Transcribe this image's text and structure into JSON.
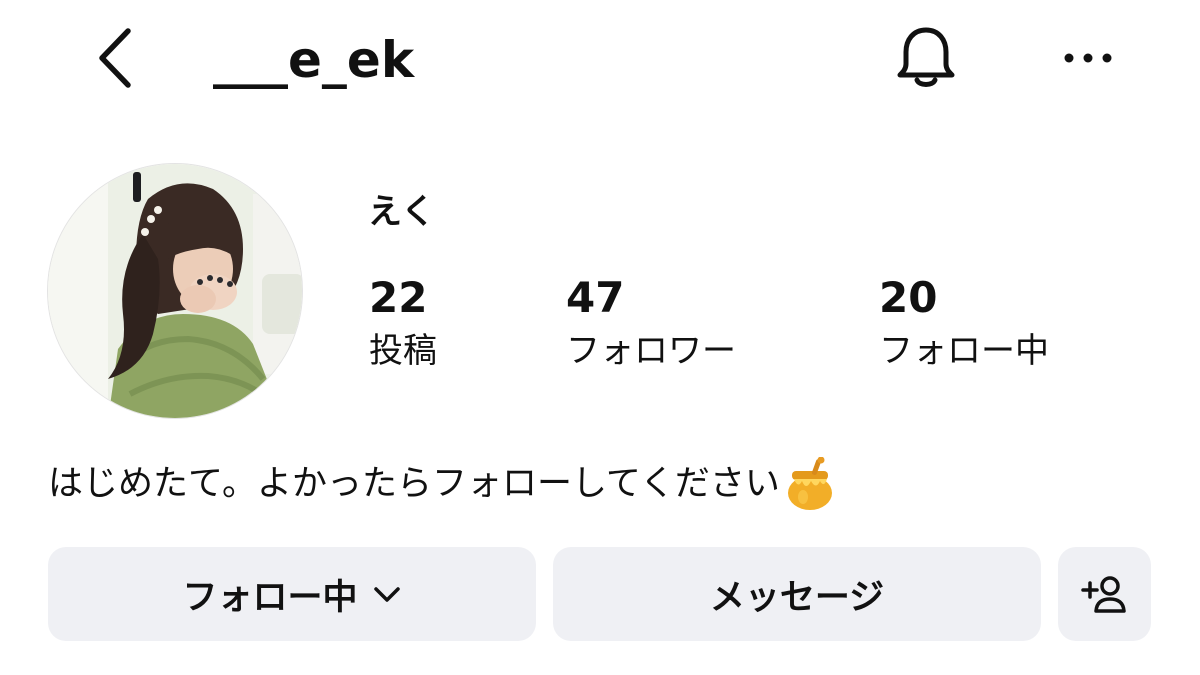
{
  "header": {
    "back_icon": "chevron-left-icon",
    "username": "___e_ek",
    "bell_icon": "bell-icon",
    "more_icon": "more-horizontal-icon"
  },
  "profile": {
    "avatar_icon": "profile-photo",
    "display_name": "えく",
    "stats": [
      {
        "count": "22",
        "label": "投稿"
      },
      {
        "count": "47",
        "label": "フォロワー"
      },
      {
        "count": "20",
        "label": "フォロー中"
      }
    ],
    "bio": "はじめたて。よかったらフォローしてください",
    "bio_emoji_icon": "honey-pot-icon"
  },
  "actions": {
    "following_label": "フォロー中",
    "following_chevron_icon": "chevron-down-icon",
    "message_label": "メッセージ",
    "add_user_icon": "add-person-icon"
  },
  "colors": {
    "text": "#111111",
    "button_bg": "#eff0f4",
    "background": "#ffffff"
  }
}
